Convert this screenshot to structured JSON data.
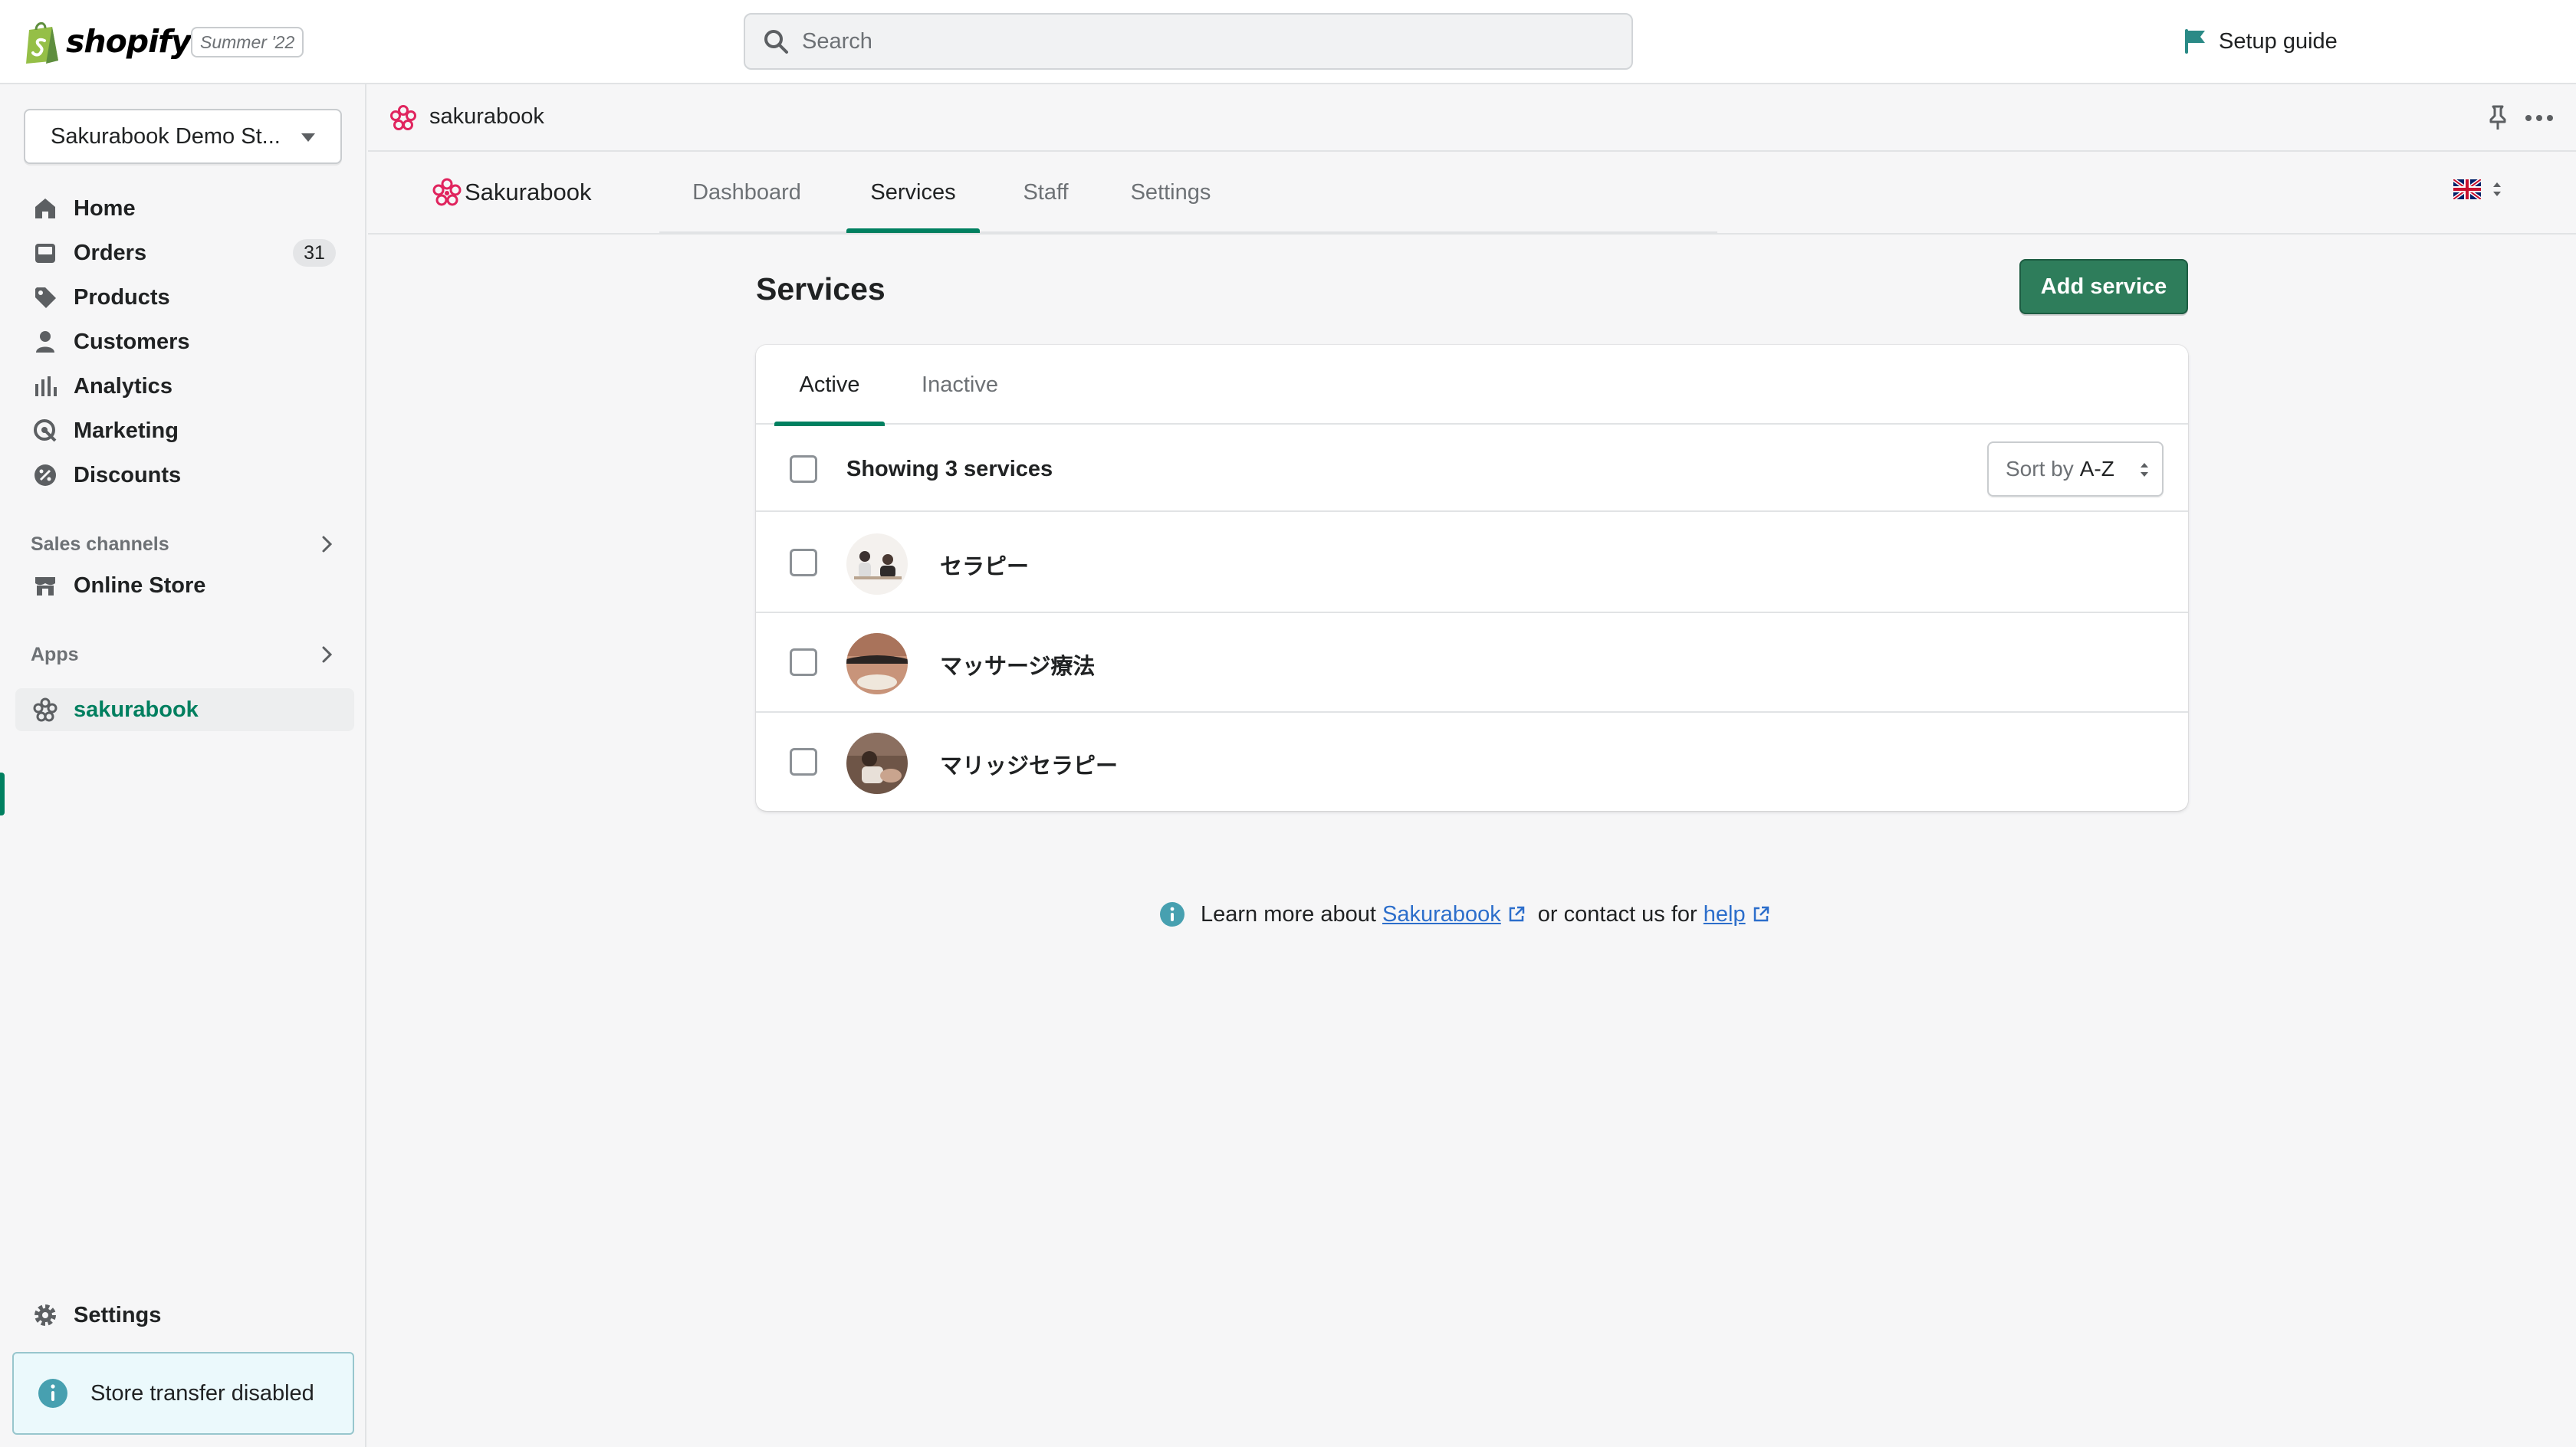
{
  "topbar": {
    "logo_text": "shopify",
    "edition_badge": "Summer '22",
    "search_placeholder": "Search",
    "setup_guide": "Setup guide"
  },
  "sidebar": {
    "store_name": "Sakurabook Demo St...",
    "items": [
      {
        "label": "Home",
        "icon": "home-icon"
      },
      {
        "label": "Orders",
        "icon": "orders-icon",
        "count": "31"
      },
      {
        "label": "Products",
        "icon": "tag-icon"
      },
      {
        "label": "Customers",
        "icon": "person-icon"
      },
      {
        "label": "Analytics",
        "icon": "bar-chart-icon"
      },
      {
        "label": "Marketing",
        "icon": "target-icon"
      },
      {
        "label": "Discounts",
        "icon": "discount-icon"
      }
    ],
    "sales_channels": {
      "heading": "Sales channels",
      "items": [
        {
          "label": "Online Store",
          "icon": "store-icon"
        }
      ]
    },
    "apps": {
      "heading": "Apps",
      "items": [
        {
          "label": "sakurabook",
          "icon": "sakura-icon",
          "active": true
        }
      ]
    },
    "settings": "Settings",
    "store_transfer": "Store transfer disabled"
  },
  "app_header": {
    "app_name": "sakurabook",
    "brand": "Sakurabook",
    "tabs": [
      {
        "label": "Dashboard",
        "active": false
      },
      {
        "label": "Services",
        "active": true
      },
      {
        "label": "Staff",
        "active": false
      },
      {
        "label": "Settings",
        "active": false
      }
    ],
    "language_flag": "uk-flag-icon"
  },
  "main": {
    "title": "Services",
    "add_button": "Add service",
    "card_tabs": [
      {
        "label": "Active",
        "active": true
      },
      {
        "label": "Inactive",
        "active": false
      }
    ],
    "showing_text": "Showing 3 services",
    "sort": {
      "label": "Sort by",
      "value": "A-Z"
    },
    "services": [
      {
        "name": "セラピー"
      },
      {
        "name": "マッサージ療法"
      },
      {
        "name": "マリッジセラピー"
      }
    ],
    "help": {
      "prefix": "Learn more about",
      "link1": "Sakurabook",
      "middle": "or contact us for",
      "link2": "help"
    }
  },
  "colors": {
    "accent": "#008060",
    "primary_button": "#2e7d5b",
    "link": "#2c6ecb",
    "sakura": "#e0245e",
    "info": "#47a0b0"
  }
}
